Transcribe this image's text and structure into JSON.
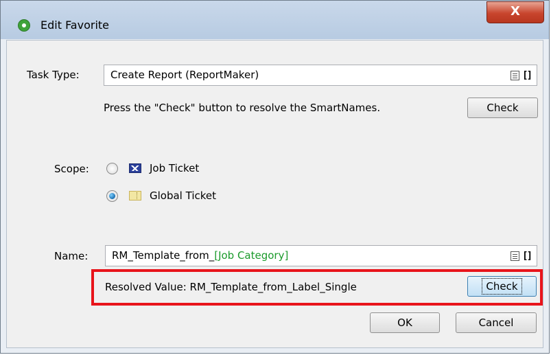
{
  "window": {
    "title": "Edit Favorite",
    "close_label": "X"
  },
  "task_type": {
    "label": "Task Type:",
    "value": "Create Report (ReportMaker)",
    "hint": "Press the \"Check\" button to resolve the SmartNames.",
    "check_label": "Check"
  },
  "scope": {
    "label": "Scope:",
    "options": [
      {
        "label": "Job Ticket",
        "selected": false,
        "icon": "job-ticket-icon"
      },
      {
        "label": "Global Ticket",
        "selected": true,
        "icon": "global-ticket-icon"
      }
    ]
  },
  "name": {
    "label": "Name:",
    "value_prefix": "RM_Template_from_",
    "value_smartname": "[Job Category]",
    "resolved_label": "Resolved Value: RM_Template_from_Label_Single",
    "check_label": "Check"
  },
  "footer": {
    "ok_label": "OK",
    "cancel_label": "Cancel"
  },
  "colors": {
    "highlight": "#e8141b",
    "smartname": "#1a9a2a"
  }
}
